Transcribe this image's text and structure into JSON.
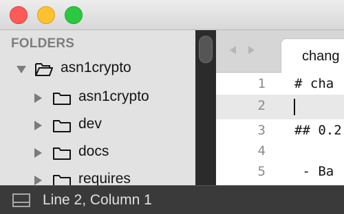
{
  "window": {
    "controls": [
      "close",
      "minimize",
      "zoom"
    ]
  },
  "sidebar": {
    "heading": "FOLDERS",
    "tree": [
      {
        "label": "asn1crypto",
        "expanded": true,
        "icon": "folder-open-icon"
      },
      {
        "label": "asn1crypto",
        "expanded": false,
        "icon": "folder-icon"
      },
      {
        "label": "dev",
        "expanded": false,
        "icon": "folder-icon"
      },
      {
        "label": "docs",
        "expanded": false,
        "icon": "folder-icon"
      },
      {
        "label": "requires",
        "expanded": false,
        "icon": "folder-icon"
      }
    ]
  },
  "tabs": {
    "active_label": "chang"
  },
  "editor": {
    "lines": [
      {
        "number": "1",
        "text": "# cha"
      },
      {
        "number": "2",
        "text": ""
      },
      {
        "number": "3",
        "text": "## 0.2"
      },
      {
        "number": "4",
        "text": ""
      },
      {
        "number": "5",
        "text": " - Ba"
      }
    ]
  },
  "status": {
    "text": "Line 2, Column 1"
  },
  "colors": {
    "close": "#fd5b58",
    "minimize": "#fec12f",
    "zoom": "#2bc840",
    "sidebar_bg": "#e2e2e2",
    "status_bg": "#3a3a3a",
    "current_line": "#e8e8e8"
  }
}
